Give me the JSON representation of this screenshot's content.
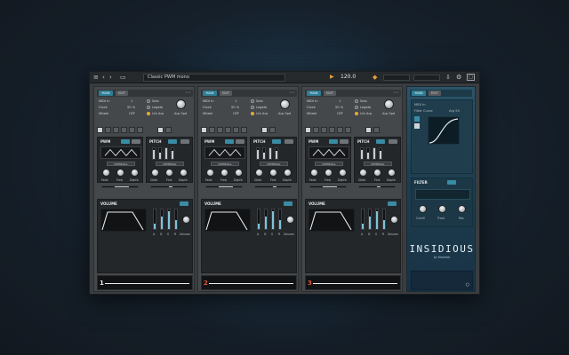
{
  "colors": {
    "accent": "#2f7d95",
    "highlight": "#e4a93e",
    "slot1_num": "#e9ecee",
    "slot2_num": "#e0573a",
    "slot3_num": "#e0573a",
    "side_bg": "#1f4052"
  },
  "topbar": {
    "preset": "Classic PWM mono",
    "tempo": "120.0",
    "play": "▶"
  },
  "slots": [
    {
      "main_tab": "MAIN",
      "layer_tab": "EDIT",
      "midi_in_label": "MIDI In",
      "midi_in_value": "1",
      "clock_label": "Clock",
      "clock_value": "50 %",
      "wheel_label": "Wheel",
      "wheel_value": "OFF",
      "solo": "Solo",
      "legato": "Legato",
      "uni_arp": "Uni Arp",
      "arp_spd": "Arp Spd",
      "pwm_title": "PWM",
      "pitch_title": "PITCH",
      "volume_title": "VOLUME",
      "sync_label": "INTERNAL",
      "knob_labels_pwm": [
        "Fade",
        "Freq",
        "Depth"
      ],
      "knob_labels_pitch": [
        "Glide",
        "Fine",
        "Depth"
      ],
      "vol_labels": [
        "A",
        "D",
        "S",
        "R",
        "Volume"
      ],
      "num": "1"
    },
    {
      "main_tab": "MAIN",
      "layer_tab": "EDIT",
      "midi_in_label": "MIDI In",
      "midi_in_value": "1",
      "clock_label": "Clock",
      "clock_value": "50 %",
      "wheel_label": "Wheel",
      "wheel_value": "OFF",
      "solo": "Solo",
      "legato": "Legato",
      "uni_arp": "Uni Arp",
      "arp_spd": "Arp Spd",
      "pwm_title": "PWM",
      "pitch_title": "PITCH",
      "volume_title": "VOLUME",
      "sync_label": "INTERNAL",
      "knob_labels_pwm": [
        "Fade",
        "Freq",
        "Depth"
      ],
      "knob_labels_pitch": [
        "Glide",
        "Fine",
        "Depth"
      ],
      "vol_labels": [
        "A",
        "D",
        "S",
        "R",
        "Volume"
      ],
      "num": "2"
    },
    {
      "main_tab": "MAIN",
      "layer_tab": "EDIT",
      "midi_in_label": "MIDI In",
      "midi_in_value": "1",
      "clock_label": "Clock",
      "clock_value": "50 %",
      "wheel_label": "Wheel",
      "wheel_value": "OFF",
      "solo": "Solo",
      "legato": "Legato",
      "uni_arp": "Uni Arp",
      "arp_spd": "Arp Spd",
      "pwm_title": "PWM",
      "pitch_title": "PITCH",
      "volume_title": "VOLUME",
      "sync_label": "INTERNAL",
      "knob_labels_pwm": [
        "Fade",
        "Freq",
        "Depth"
      ],
      "knob_labels_pitch": [
        "Glide",
        "Fine",
        "Depth"
      ],
      "vol_labels": [
        "A",
        "D",
        "S",
        "R",
        "Volume"
      ],
      "num": "3"
    }
  ],
  "side": {
    "main_tab": "MAIN",
    "layer_tab": "EDIT",
    "midi_in": "MIDI In",
    "filter_curve": "Filter Curve",
    "filter_curve_value": "Arg 50",
    "filter_title": "FILTER",
    "filter_knobs": [
      "Cutoff",
      "Track",
      "Res"
    ],
    "brand": "INSIDIOUS",
    "brand_sub": "by Wavelab"
  }
}
